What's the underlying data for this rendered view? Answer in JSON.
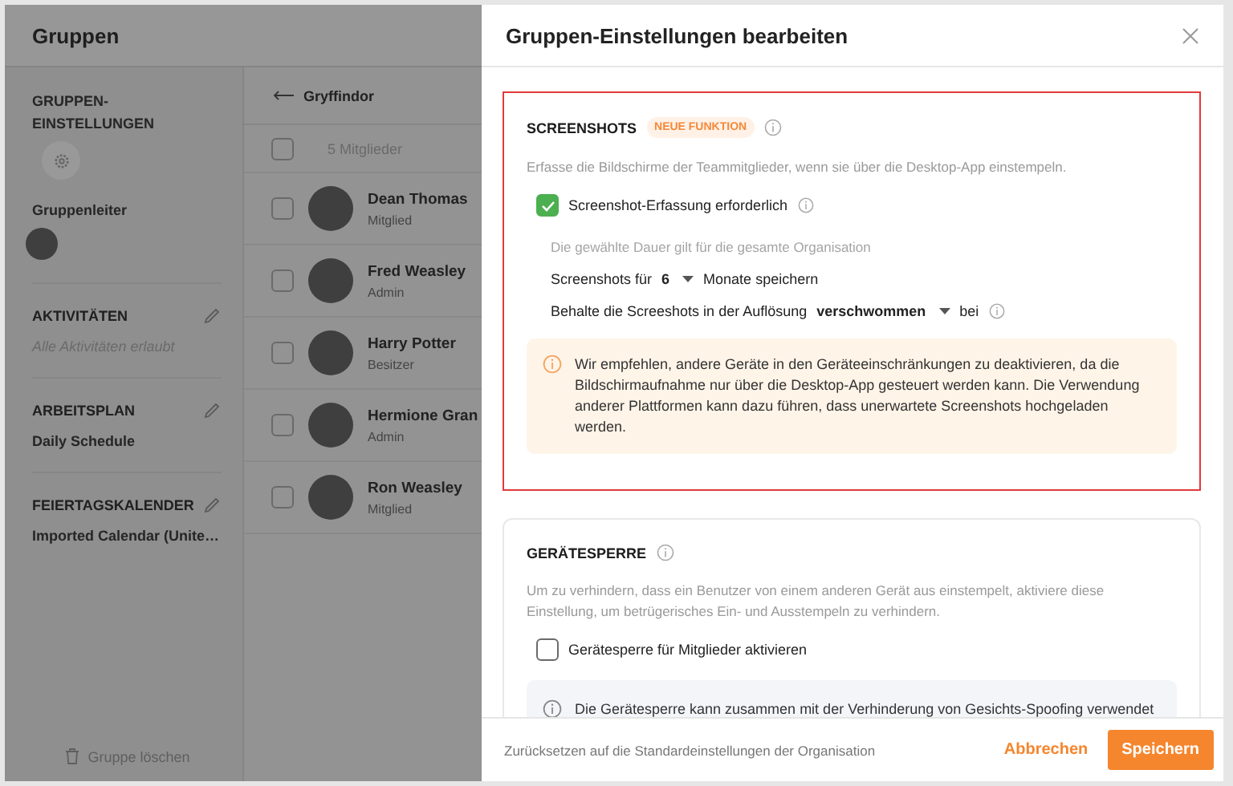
{
  "app": {
    "title": "Gruppen"
  },
  "sidebar": {
    "settings_heading": "GRUPPEN-EINSTELLUNGEN",
    "leader_label": "Gruppenleiter",
    "sections": [
      {
        "title": "AKTIVITÄTEN",
        "value": "Alle Aktivitäten erlaubt",
        "kind": "muted"
      },
      {
        "title": "ARBEITSPLAN",
        "value": "Daily Schedule",
        "kind": "plain"
      },
      {
        "title": "FEIERTAGSKALENDER",
        "value": "Imported Calendar (Unite…",
        "kind": "plain"
      }
    ],
    "delete_label": "Gruppe löschen"
  },
  "members": {
    "group": "Gryffindor",
    "count": "5 Mitglieder",
    "all_checked": false,
    "items": [
      {
        "name": "Dean Thomas",
        "role": "Mitglied",
        "checked": false
      },
      {
        "name": "Fred Weasley",
        "role": "Admin",
        "checked": false
      },
      {
        "name": "Harry Potter",
        "role": "Besitzer",
        "checked": false
      },
      {
        "name": "Hermione Gran",
        "role": "Admin",
        "checked": false
      },
      {
        "name": "Ron Weasley",
        "role": "Mitglied",
        "checked": false
      }
    ]
  },
  "drawer": {
    "title": "Gruppen-Einstellungen bearbeiten",
    "sections": [
      {
        "kind": "screenshots",
        "highlighted": true,
        "title": "SCREENSHOTS",
        "badge": "NEUE FUNKTION",
        "description": "Erfasse die Bildschirme der Teammitglieder, wenn sie über die Desktop-App einstempeln.",
        "checkbox": {
          "label": "Screenshot-Erfassung erforderlich",
          "checked": true
        },
        "note": "Die gewählte Dauer gilt für die gesamte Organisation",
        "retention": {
          "prefix": "Screenshots für",
          "value": "6",
          "suffix": "Monate speichern"
        },
        "resolution": {
          "prefix": "Behalte die Screeshots in der Auflösung",
          "value": "verschwommen",
          "suffix": "bei"
        },
        "warning": "Wir empfehlen, andere Geräte in den Geräteeinschränkungen zu deaktivieren, da die Bildschirmaufnahme nur über die Desktop-App gesteuert werden kann. Die Verwendung anderer Plattformen kann dazu führen, dass unerwartete Screenshots hochgeladen werden."
      },
      {
        "kind": "device_lock",
        "highlighted": false,
        "title": "GERÄTESPERRE",
        "description": "Um zu verhindern, dass ein Benutzer von einem anderen Gerät aus einstempelt, aktiviere diese Einstellung, um betrügerisches Ein- und Ausstempeln zu verhindern.",
        "checkbox": {
          "label": "Gerätesperre für Mitglieder aktivieren",
          "checked": false
        },
        "info": "Die Gerätesperre kann zusammen mit der Verhinderung von Gesichts-Spoofing verwendet"
      }
    ]
  },
  "footer": {
    "reset": "Zurücksetzen auf die Standardeinstellungen der Organisation",
    "cancel": "Abbrechen",
    "save": "Speichern"
  }
}
